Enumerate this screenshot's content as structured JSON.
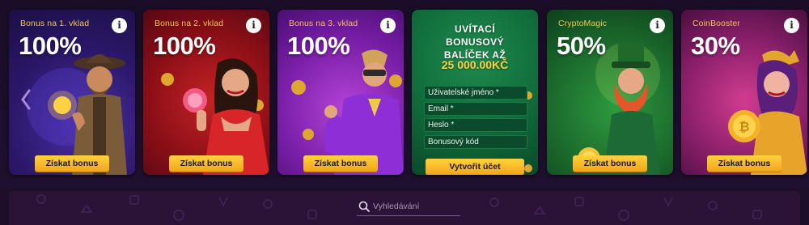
{
  "cards": [
    {
      "tag": "Bonus na 1. vklad",
      "pct": "100%",
      "button": "Získat bonus"
    },
    {
      "tag": "Bonus na 2. vklad",
      "pct": "100%",
      "button": "Získat bonus"
    },
    {
      "tag": "Bonus na 3. vklad",
      "pct": "100%",
      "button": "Získat bonus"
    },
    {
      "tag": "CryptoMagic",
      "pct": "50%",
      "button": "Získat bonus"
    },
    {
      "tag": "CoinBooster",
      "pct": "30%",
      "button": "Získat bonus"
    }
  ],
  "info_glyph": "i",
  "welcome": {
    "line1": "UVÍTACÍ",
    "line2": "BONUSOVÝ",
    "line3": "BALÍČEK AŽ",
    "amount": "25 000.00KČ",
    "fields": {
      "username": "Uživatelské jméno *",
      "email": "Email *",
      "password": "Heslo *",
      "bonus_code": "Bonusový kód"
    },
    "submit": "Vytvořit účet"
  },
  "search": {
    "placeholder": "Vyhledávání"
  },
  "colors": {
    "button": "#f5b92a",
    "tag": "#f3c44a",
    "bar": "#2b1338"
  }
}
